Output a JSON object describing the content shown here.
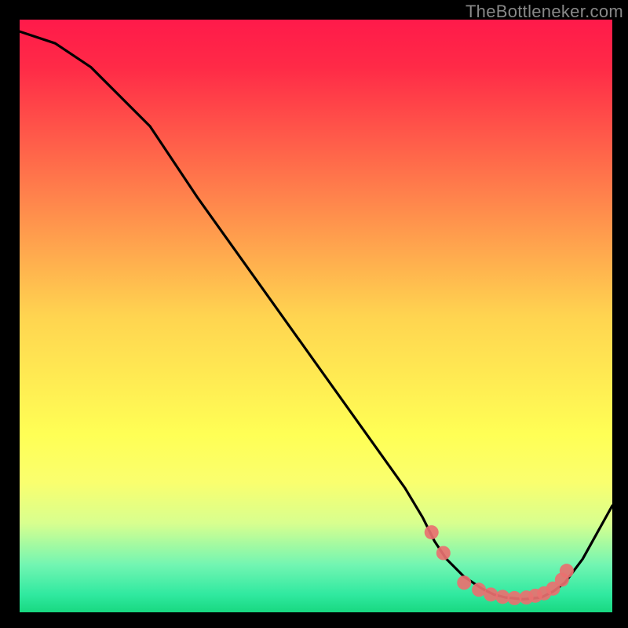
{
  "watermark": "TheBottleneker.com",
  "chart_data": {
    "type": "line",
    "title": "",
    "xlabel": "",
    "ylabel": "",
    "xlim": [
      0,
      100
    ],
    "ylim": [
      0,
      100
    ],
    "grid": false,
    "background_gradient": {
      "stops": [
        {
          "offset": 0.0,
          "color": "#ff1a4a"
        },
        {
          "offset": 0.08,
          "color": "#ff2a47"
        },
        {
          "offset": 0.5,
          "color": "#ffd450"
        },
        {
          "offset": 0.7,
          "color": "#ffff55"
        },
        {
          "offset": 0.78,
          "color": "#faff6e"
        },
        {
          "offset": 0.85,
          "color": "#d8ff8f"
        },
        {
          "offset": 0.92,
          "color": "#72f5b2"
        },
        {
          "offset": 0.97,
          "color": "#30e9a0"
        },
        {
          "offset": 1.0,
          "color": "#18d880"
        }
      ]
    },
    "series": [
      {
        "name": "bottleneck-curve",
        "color": "#000000",
        "x": [
          0,
          6,
          12,
          17,
          22,
          30,
          40,
          50,
          60,
          65,
          68,
          70,
          72,
          75,
          78,
          80,
          82,
          85,
          88,
          90,
          92,
          95,
          100
        ],
        "y": [
          98,
          96,
          92,
          87,
          82,
          70,
          56,
          42,
          28,
          21,
          16,
          12,
          9,
          6,
          4,
          3,
          2.5,
          2.2,
          2.5,
          3.5,
          5,
          9,
          18
        ]
      }
    ],
    "markers": {
      "name": "highlight-dots",
      "color": "#e97070",
      "radius": 9,
      "points": [
        {
          "x": 69.5,
          "y": 13.5
        },
        {
          "x": 71.5,
          "y": 10
        },
        {
          "x": 75,
          "y": 5
        },
        {
          "x": 77.5,
          "y": 3.8
        },
        {
          "x": 79.5,
          "y": 3
        },
        {
          "x": 81.5,
          "y": 2.6
        },
        {
          "x": 83.5,
          "y": 2.4
        },
        {
          "x": 85.5,
          "y": 2.5
        },
        {
          "x": 87,
          "y": 2.8
        },
        {
          "x": 88.5,
          "y": 3.2
        },
        {
          "x": 90,
          "y": 4
        },
        {
          "x": 91.5,
          "y": 5.5
        },
        {
          "x": 92.3,
          "y": 7
        }
      ]
    }
  }
}
